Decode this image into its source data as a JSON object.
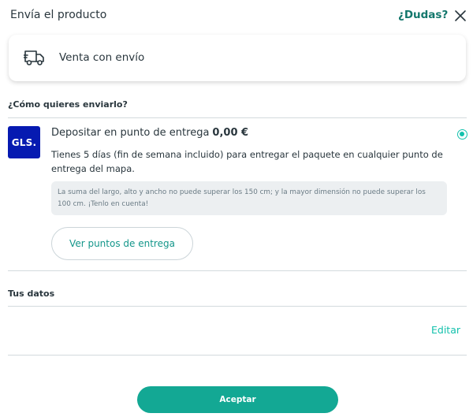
{
  "header": {
    "title": "Envía el producto",
    "help_label": "¿Dudas?"
  },
  "shipping_type": {
    "label": "Venta con envío"
  },
  "delivery_section": {
    "title": "¿Cómo quieres enviarlo?",
    "option": {
      "carrier_logo_text": "GLS.",
      "title": "Depositar en punto de entrega",
      "price": "0,00 €",
      "selected": true,
      "description": "Tienes 5 días (fin de semana incluido) para entregar el paquete en cualquier punto de entrega del mapa.",
      "note": "La suma del largo, alto y ancho no puede superar los 150 cm; y la mayor dimensión no puede superar los 100 cm. ¡Tenlo en cuenta!",
      "points_button_label": "Ver puntos de entrega"
    }
  },
  "your_data_section": {
    "title": "Tus datos",
    "edit_label": "Editar"
  },
  "footer": {
    "accept_label": "Aceptar"
  },
  "colors": {
    "accent": "#13c1ac",
    "accept_button": "#13a894",
    "gls_blue": "#061ab1"
  }
}
